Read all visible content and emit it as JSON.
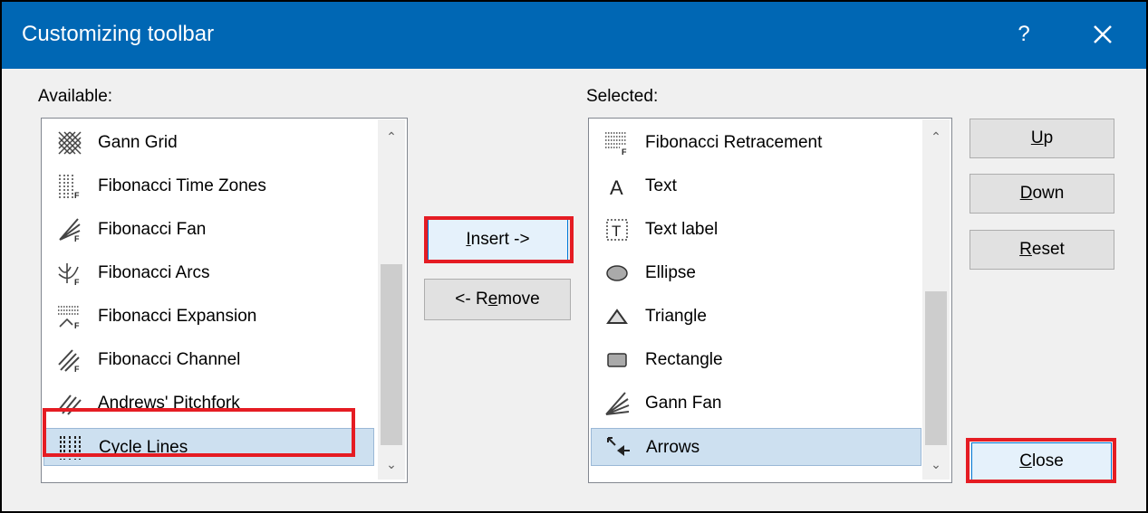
{
  "window": {
    "title": "Customizing toolbar",
    "help": "?"
  },
  "available": {
    "label": "Available:",
    "items": [
      {
        "label": "Gann Grid",
        "icon": "gann-grid-icon"
      },
      {
        "label": "Fibonacci Time Zones",
        "icon": "fibonacci-time-zones-icon"
      },
      {
        "label": "Fibonacci Fan",
        "icon": "fibonacci-fan-icon"
      },
      {
        "label": "Fibonacci Arcs",
        "icon": "fibonacci-arcs-icon"
      },
      {
        "label": "Fibonacci Expansion",
        "icon": "fibonacci-expansion-icon"
      },
      {
        "label": "Fibonacci Channel",
        "icon": "fibonacci-channel-icon"
      },
      {
        "label": "Andrews' Pitchfork",
        "icon": "andrews-pitchfork-icon"
      },
      {
        "label": "Cycle Lines",
        "icon": "cycle-lines-icon",
        "selected": true
      }
    ]
  },
  "selected": {
    "label": "Selected:",
    "items": [
      {
        "label": "Fibonacci Retracement",
        "icon": "fibonacci-retracement-icon"
      },
      {
        "label": "Text",
        "icon": "text-icon"
      },
      {
        "label": "Text label",
        "icon": "text-label-icon"
      },
      {
        "label": "Ellipse",
        "icon": "ellipse-icon"
      },
      {
        "label": "Triangle",
        "icon": "triangle-icon"
      },
      {
        "label": "Rectangle",
        "icon": "rectangle-icon"
      },
      {
        "label": "Gann Fan",
        "icon": "gann-fan-icon"
      },
      {
        "label": "Arrows",
        "icon": "arrows-icon",
        "selected": true
      }
    ]
  },
  "buttons": {
    "insert": {
      "pre": "",
      "key": "I",
      "post": "nsert ->"
    },
    "remove": {
      "pre": "<- R",
      "key": "e",
      "post": "move"
    },
    "up": {
      "pre": "",
      "key": "U",
      "post": "p"
    },
    "down": {
      "pre": "",
      "key": "D",
      "post": "own"
    },
    "reset": {
      "pre": "",
      "key": "R",
      "post": "eset"
    },
    "close": {
      "pre": "",
      "key": "C",
      "post": "lose"
    }
  },
  "colors": {
    "title_bar": "#0067b4",
    "selection": "#cde0f0",
    "highlight_box": "#e51c23"
  }
}
